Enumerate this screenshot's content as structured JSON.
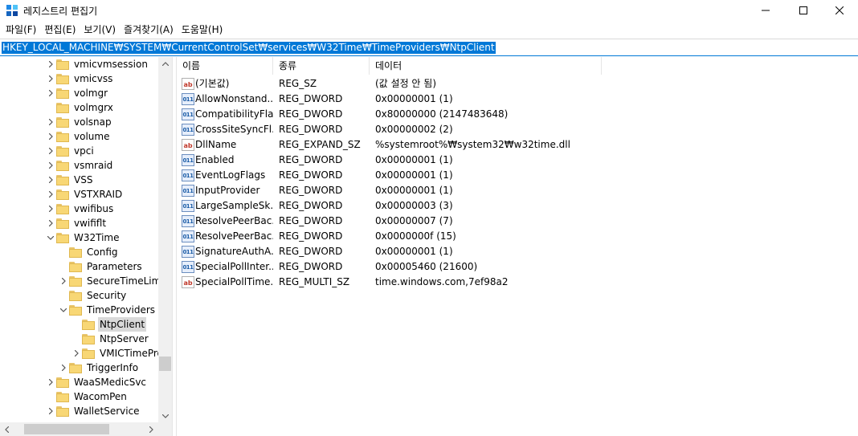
{
  "window": {
    "title": "레지스트리 편집기",
    "minimize_glyph": "—",
    "maximize_glyph": "☐",
    "close_glyph": "✕"
  },
  "menu": [
    "파일(F)",
    "편집(E)",
    "보기(V)",
    "즐겨찾기(A)",
    "도움말(H)"
  ],
  "address": "HKEY_LOCAL_MACHINE₩SYSTEM₩CurrentControlSet₩services₩W32Time₩TimeProviders₩NtpClient",
  "tree": {
    "items": [
      {
        "label": "vmicvmsession",
        "level": 0,
        "expander": ">",
        "selected": false
      },
      {
        "label": "vmicvss",
        "level": 0,
        "expander": ">",
        "selected": false
      },
      {
        "label": "volmgr",
        "level": 0,
        "expander": ">",
        "selected": false
      },
      {
        "label": "volmgrx",
        "level": 0,
        "expander": "",
        "selected": false
      },
      {
        "label": "volsnap",
        "level": 0,
        "expander": ">",
        "selected": false
      },
      {
        "label": "volume",
        "level": 0,
        "expander": ">",
        "selected": false
      },
      {
        "label": "vpci",
        "level": 0,
        "expander": ">",
        "selected": false
      },
      {
        "label": "vsmraid",
        "level": 0,
        "expander": ">",
        "selected": false
      },
      {
        "label": "VSS",
        "level": 0,
        "expander": ">",
        "selected": false
      },
      {
        "label": "VSTXRAID",
        "level": 0,
        "expander": ">",
        "selected": false
      },
      {
        "label": "vwifibus",
        "level": 0,
        "expander": ">",
        "selected": false
      },
      {
        "label": "vwififlt",
        "level": 0,
        "expander": ">",
        "selected": false
      },
      {
        "label": "W32Time",
        "level": 0,
        "expander": "v",
        "selected": false
      },
      {
        "label": "Config",
        "level": 1,
        "expander": "",
        "selected": false
      },
      {
        "label": "Parameters",
        "level": 1,
        "expander": "",
        "selected": false
      },
      {
        "label": "SecureTimeLimit",
        "level": 1,
        "expander": ">",
        "selected": false
      },
      {
        "label": "Security",
        "level": 1,
        "expander": "",
        "selected": false
      },
      {
        "label": "TimeProviders",
        "level": 1,
        "expander": "v",
        "selected": false
      },
      {
        "label": "NtpClient",
        "level": 2,
        "expander": "",
        "selected": true
      },
      {
        "label": "NtpServer",
        "level": 2,
        "expander": "",
        "selected": false
      },
      {
        "label": "VMICTimePro",
        "level": 2,
        "expander": ">",
        "selected": false
      },
      {
        "label": "TriggerInfo",
        "level": 1,
        "expander": ">",
        "selected": false
      },
      {
        "label": "WaaSMedicSvc",
        "level": 0,
        "expander": ">",
        "selected": false
      },
      {
        "label": "WacomPen",
        "level": 0,
        "expander": "",
        "selected": false
      },
      {
        "label": "WalletService",
        "level": 0,
        "expander": ">",
        "selected": false
      }
    ]
  },
  "list": {
    "columns": [
      "이름",
      "종류",
      "데이터"
    ],
    "rows": [
      {
        "icon": "string",
        "name": "(기본값)",
        "type": "REG_SZ",
        "data": "(값 설정 안 됨)"
      },
      {
        "icon": "binary",
        "name": "AllowNonstand...",
        "type": "REG_DWORD",
        "data": "0x00000001 (1)"
      },
      {
        "icon": "binary",
        "name": "CompatibilityFla...",
        "type": "REG_DWORD",
        "data": "0x80000000 (2147483648)"
      },
      {
        "icon": "binary",
        "name": "CrossSiteSyncFl...",
        "type": "REG_DWORD",
        "data": "0x00000002 (2)"
      },
      {
        "icon": "string",
        "name": "DllName",
        "type": "REG_EXPAND_SZ",
        "data": "%systemroot%₩system32₩w32time.dll"
      },
      {
        "icon": "binary",
        "name": "Enabled",
        "type": "REG_DWORD",
        "data": "0x00000001 (1)"
      },
      {
        "icon": "binary",
        "name": "EventLogFlags",
        "type": "REG_DWORD",
        "data": "0x00000001 (1)"
      },
      {
        "icon": "binary",
        "name": "InputProvider",
        "type": "REG_DWORD",
        "data": "0x00000001 (1)"
      },
      {
        "icon": "binary",
        "name": "LargeSampleSk...",
        "type": "REG_DWORD",
        "data": "0x00000003 (3)"
      },
      {
        "icon": "binary",
        "name": "ResolvePeerBac...",
        "type": "REG_DWORD",
        "data": "0x00000007 (7)"
      },
      {
        "icon": "binary",
        "name": "ResolvePeerBac...",
        "type": "REG_DWORD",
        "data": "0x0000000f (15)"
      },
      {
        "icon": "binary",
        "name": "SignatureAuthA...",
        "type": "REG_DWORD",
        "data": "0x00000001 (1)"
      },
      {
        "icon": "binary",
        "name": "SpecialPollInter...",
        "type": "REG_DWORD",
        "data": "0x00005460 (21600)"
      },
      {
        "icon": "string",
        "name": "SpecialPollTime...",
        "type": "REG_MULTI_SZ",
        "data": "time.windows.com,7ef98a2"
      }
    ]
  },
  "colors": {
    "selection": "#0078d7",
    "tree_selected": "#d9d9d9",
    "folder": "#f8d775"
  }
}
